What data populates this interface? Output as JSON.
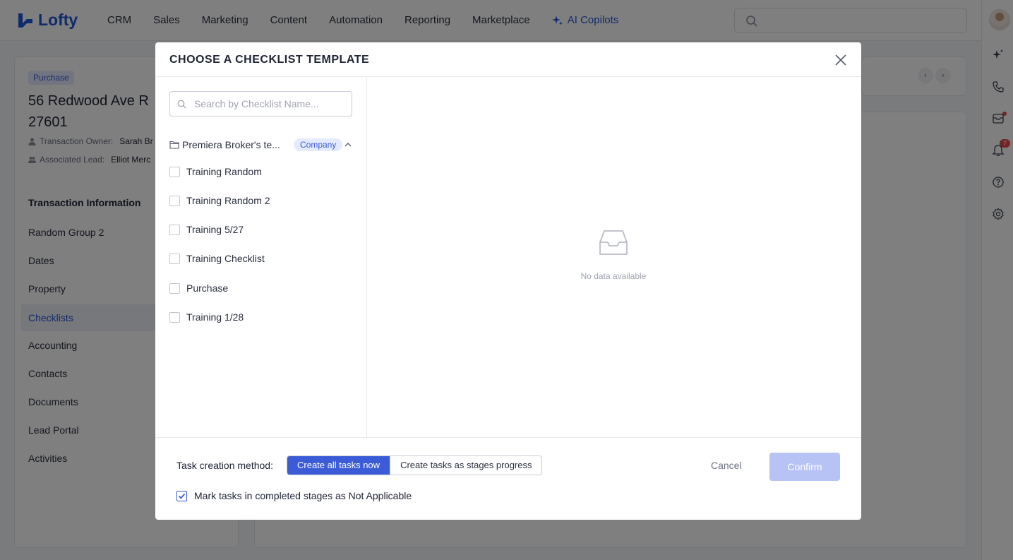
{
  "app": {
    "brand": "Lofty"
  },
  "nav": {
    "items": [
      "CRM",
      "Sales",
      "Marketing",
      "Content",
      "Automation",
      "Reporting",
      "Marketplace"
    ],
    "ai_label": "AI Copilots"
  },
  "rail": {
    "notification_count": "7"
  },
  "transaction": {
    "type_badge": "Purchase",
    "address": "56 Redwood Ave R 27601",
    "owner_label": "Transaction Owner:",
    "owner_value": "Sarah Br",
    "lead_label": "Associated Lead:",
    "lead_value": "Elliot Merc"
  },
  "sidebar": {
    "section_title": "Transaction Information",
    "items": [
      "Random Group 2",
      "Dates",
      "Property",
      "Checklists",
      "Accounting",
      "Contacts",
      "Documents",
      "Lead Portal",
      "Activities"
    ],
    "active": "Checklists"
  },
  "modal": {
    "title": "CHOOSE A CHECKLIST TEMPLATE",
    "search_placeholder": "Search by Checklist Name...",
    "folder_name": "Premiera Broker's te...",
    "folder_tag": "Company",
    "templates": [
      "Training Random",
      "Training Random 2",
      "Training 5/27",
      "Training Checklist",
      "Purchase",
      "Training 1/28"
    ],
    "empty_text": "No data available",
    "footer": {
      "method_label": "Task creation method:",
      "method_options": [
        "Create all tasks now",
        "Create tasks as stages progress"
      ],
      "method_selected": "Create all tasks now",
      "mark_label": "Mark tasks in completed stages as Not Applicable",
      "mark_checked": true,
      "cancel_label": "Cancel",
      "confirm_label": "Confirm"
    }
  },
  "colors": {
    "accent": "#3b5cd6",
    "brand": "#1f56d6",
    "confirm_disabled": "#b7c2f5",
    "notification": "#e24a4a"
  }
}
